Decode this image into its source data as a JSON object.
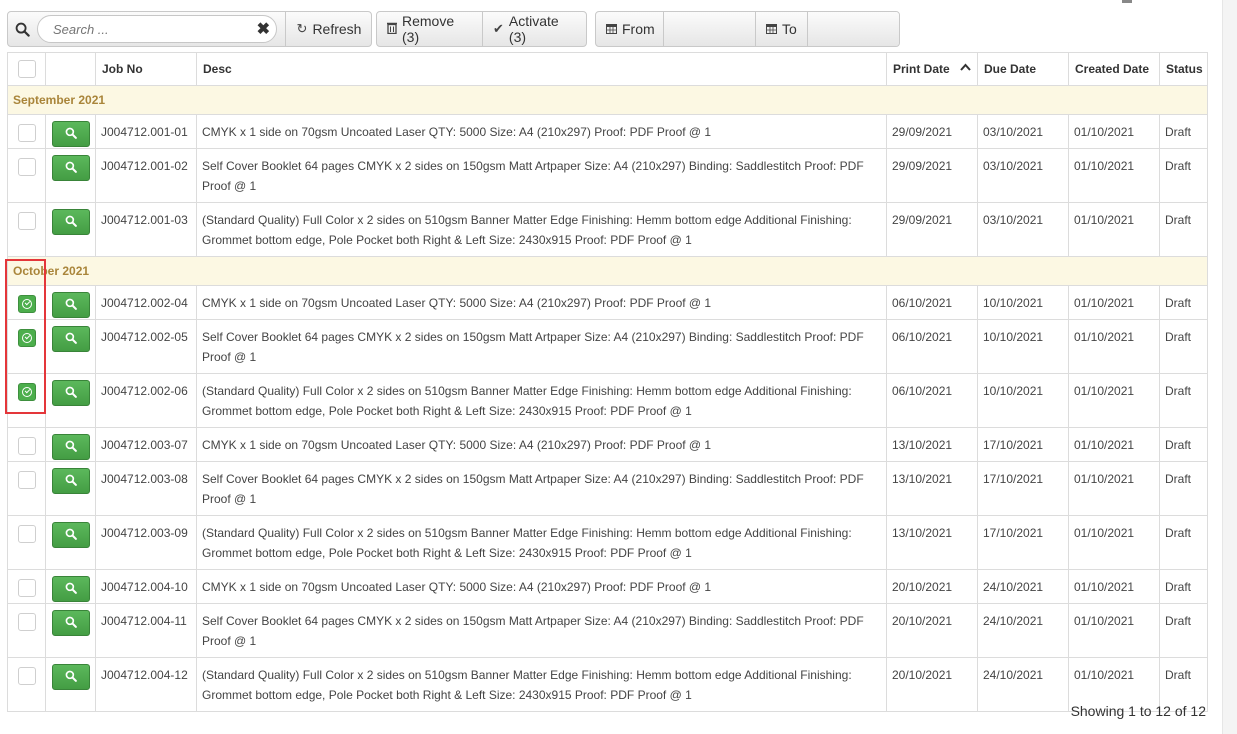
{
  "toolbar": {
    "search_placeholder": "Search ...",
    "refresh_label": "Refresh",
    "remove_label": "Remove (3)",
    "activate_label": "Activate (3)",
    "from_label": "From",
    "to_label": "To"
  },
  "columns": {
    "job_no": "Job No",
    "desc": "Desc",
    "print_date": "Print Date",
    "due_date": "Due Date",
    "created_date": "Created Date",
    "status": "Status"
  },
  "groups": [
    {
      "label": "September 2021",
      "rows": [
        {
          "checked": false,
          "job_no": "J004712.001-01",
          "desc": "CMYK x 1 side on 70gsm Uncoated Laser QTY: 5000 Size: A4 (210x297) Proof: PDF Proof @ 1",
          "print_date": "29/09/2021",
          "due_date": "03/10/2021",
          "created_date": "01/10/2021",
          "status": "Draft"
        },
        {
          "checked": false,
          "job_no": "J004712.001-02",
          "desc": "Self Cover Booklet 64 pages CMYK x 2 sides on 150gsm Matt Artpaper Size: A4 (210x297) Binding: Saddlestitch Proof: PDF Proof @ 1",
          "print_date": "29/09/2021",
          "due_date": "03/10/2021",
          "created_date": "01/10/2021",
          "status": "Draft"
        },
        {
          "checked": false,
          "job_no": "J004712.001-03",
          "desc": "(Standard Quality) Full Color x 2 sides on 510gsm Banner Matter Edge Finishing: Hemm bottom edge Additional Finishing: Grommet bottom edge, Pole Pocket both Right & Left Size: 2430x915 Proof: PDF Proof @ 1",
          "print_date": "29/09/2021",
          "due_date": "03/10/2021",
          "created_date": "01/10/2021",
          "status": "Draft"
        }
      ]
    },
    {
      "label": "October 2021",
      "rows": [
        {
          "checked": true,
          "job_no": "J004712.002-04",
          "desc": "CMYK x 1 side on 70gsm Uncoated Laser QTY: 5000 Size: A4 (210x297) Proof: PDF Proof @ 1",
          "print_date": "06/10/2021",
          "due_date": "10/10/2021",
          "created_date": "01/10/2021",
          "status": "Draft"
        },
        {
          "checked": true,
          "job_no": "J004712.002-05",
          "desc": "Self Cover Booklet 64 pages CMYK x 2 sides on 150gsm Matt Artpaper Size: A4 (210x297) Binding: Saddlestitch Proof: PDF Proof @ 1",
          "print_date": "06/10/2021",
          "due_date": "10/10/2021",
          "created_date": "01/10/2021",
          "status": "Draft"
        },
        {
          "checked": true,
          "job_no": "J004712.002-06",
          "desc": "(Standard Quality) Full Color x 2 sides on 510gsm Banner Matter Edge Finishing: Hemm bottom edge Additional Finishing: Grommet bottom edge, Pole Pocket both Right & Left Size: 2430x915 Proof: PDF Proof @ 1",
          "print_date": "06/10/2021",
          "due_date": "10/10/2021",
          "created_date": "01/10/2021",
          "status": "Draft"
        },
        {
          "checked": false,
          "job_no": "J004712.003-07",
          "desc": "CMYK x 1 side on 70gsm Uncoated Laser QTY: 5000 Size: A4 (210x297) Proof: PDF Proof @ 1",
          "print_date": "13/10/2021",
          "due_date": "17/10/2021",
          "created_date": "01/10/2021",
          "status": "Draft"
        },
        {
          "checked": false,
          "job_no": "J004712.003-08",
          "desc": "Self Cover Booklet 64 pages CMYK x 2 sides on 150gsm Matt Artpaper Size: A4 (210x297) Binding: Saddlestitch Proof: PDF Proof @ 1",
          "print_date": "13/10/2021",
          "due_date": "17/10/2021",
          "created_date": "01/10/2021",
          "status": "Draft"
        },
        {
          "checked": false,
          "job_no": "J004712.003-09",
          "desc": "(Standard Quality) Full Color x 2 sides on 510gsm Banner Matter Edge Finishing: Hemm bottom edge Additional Finishing: Grommet bottom edge, Pole Pocket both Right & Left Size: 2430x915 Proof: PDF Proof @ 1",
          "print_date": "13/10/2021",
          "due_date": "17/10/2021",
          "created_date": "01/10/2021",
          "status": "Draft"
        },
        {
          "checked": false,
          "job_no": "J004712.004-10",
          "desc": "CMYK x 1 side on 70gsm Uncoated Laser QTY: 5000 Size: A4 (210x297) Proof: PDF Proof @ 1",
          "print_date": "20/10/2021",
          "due_date": "24/10/2021",
          "created_date": "01/10/2021",
          "status": "Draft"
        },
        {
          "checked": false,
          "job_no": "J004712.004-11",
          "desc": "Self Cover Booklet 64 pages CMYK x 2 sides on 150gsm Matt Artpaper Size: A4 (210x297) Binding: Saddlestitch Proof: PDF Proof @ 1",
          "print_date": "20/10/2021",
          "due_date": "24/10/2021",
          "created_date": "01/10/2021",
          "status": "Draft"
        },
        {
          "checked": false,
          "job_no": "J004712.004-12",
          "desc": "(Standard Quality) Full Color x 2 sides on 510gsm Banner Matter Edge Finishing: Hemm bottom edge Additional Finishing: Grommet bottom edge, Pole Pocket both Right & Left Size: 2430x915 Proof: PDF Proof @ 1",
          "print_date": "20/10/2021",
          "due_date": "24/10/2021",
          "created_date": "01/10/2021",
          "status": "Draft"
        }
      ]
    }
  ],
  "footer": {
    "info": "Showing 1 to 12 of 12"
  },
  "colors": {
    "accent_green": "#5cb85c",
    "group_bg": "#fcf8e3",
    "group_text": "#a9853a",
    "highlight_red": "#e4363a"
  },
  "icons": {
    "search": "search-icon",
    "clear": "close-icon",
    "refresh": "refresh-icon",
    "remove": "trash-icon",
    "activate": "check-icon",
    "calendar": "calendar-icon",
    "view": "magnifier-icon",
    "sort": "sort-asc-icon"
  }
}
